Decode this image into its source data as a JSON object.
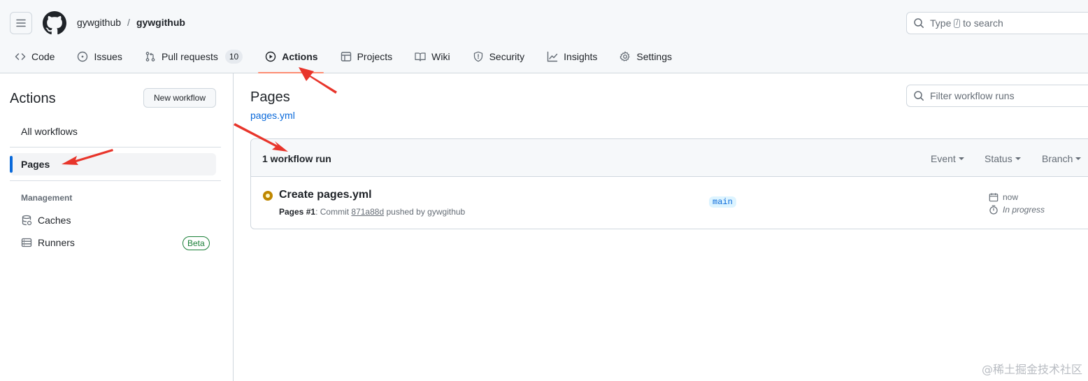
{
  "header": {
    "owner": "gywgithub",
    "separator": "/",
    "repo": "gywgithub",
    "search": {
      "prefix": "Type",
      "key": "/",
      "suffix": "to search"
    }
  },
  "tabs": [
    {
      "label": "Code",
      "icon": "code-icon"
    },
    {
      "label": "Issues",
      "icon": "issue-opened-icon"
    },
    {
      "label": "Pull requests",
      "icon": "git-pull-request-icon",
      "counter": "10"
    },
    {
      "label": "Actions",
      "icon": "play-icon",
      "active": true
    },
    {
      "label": "Projects",
      "icon": "table-icon"
    },
    {
      "label": "Wiki",
      "icon": "book-icon"
    },
    {
      "label": "Security",
      "icon": "shield-icon"
    },
    {
      "label": "Insights",
      "icon": "graph-icon"
    },
    {
      "label": "Settings",
      "icon": "gear-icon"
    }
  ],
  "sidebar": {
    "title": "Actions",
    "new_workflow": "New workflow",
    "all_workflows": "All workflows",
    "active_workflow": "Pages",
    "management_heading": "Management",
    "caches": "Caches",
    "runners": "Runners",
    "beta": "Beta"
  },
  "main": {
    "title": "Pages",
    "subtitle": "pages.yml",
    "filter_placeholder": "Filter workflow runs",
    "runs_count": "1 workflow run",
    "filters": {
      "event": "Event",
      "status": "Status",
      "branch": "Branch"
    },
    "run": {
      "title": "Create pages.yml",
      "workflow": "Pages",
      "number": "#1",
      "commit_prefix": ": Commit",
      "sha": "871a88d",
      "pushed_by": "pushed by gywgithub",
      "branch": "main",
      "time": "now",
      "state": "In progress"
    }
  },
  "colors": {
    "accent": "#0969da",
    "tab_underline": "#fd8c73",
    "in_progress": "#bf8700",
    "beta_green": "#1a7f37",
    "annotation_arrow": "#e8352b"
  },
  "watermark": "@稀土掘金技术社区"
}
